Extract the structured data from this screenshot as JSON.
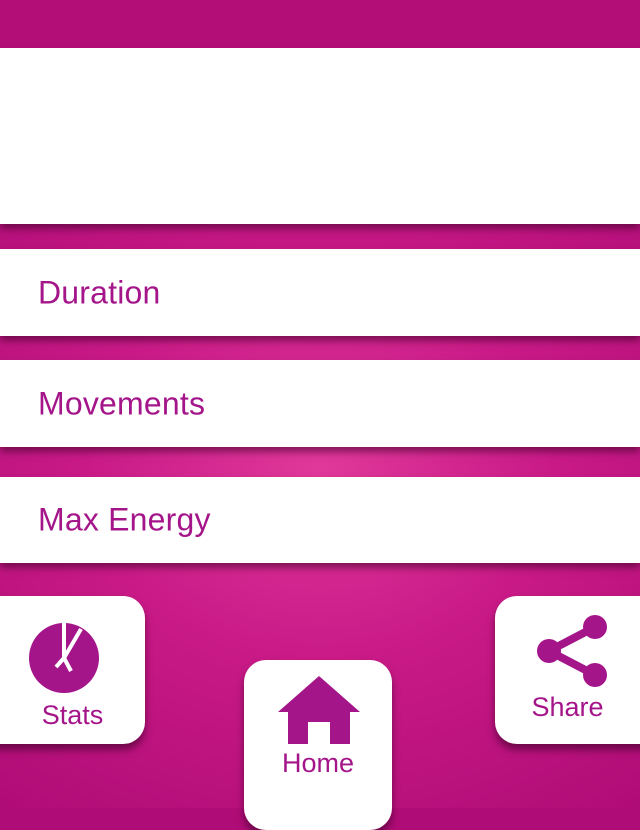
{
  "rows": [
    {
      "label": "Duration"
    },
    {
      "label": "Movements"
    },
    {
      "label": "Max Energy"
    }
  ],
  "nav": {
    "stats": {
      "label": "Stats",
      "icon": "pie-chart-icon"
    },
    "home": {
      "label": "Home",
      "icon": "house-icon"
    },
    "share": {
      "label": "Share",
      "icon": "share-icon"
    }
  },
  "colors": {
    "background": "#c91a87",
    "top_bar": "#b30d77",
    "accent_text": "#a5158a",
    "panel": "#ffffff"
  }
}
